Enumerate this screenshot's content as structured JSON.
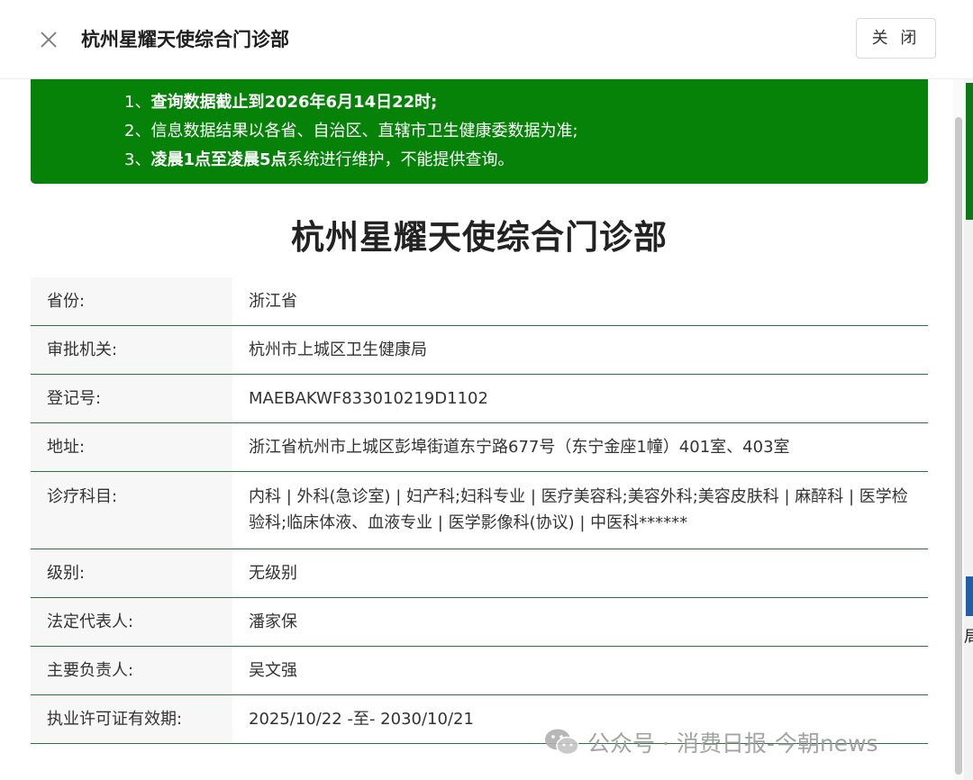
{
  "modal": {
    "title": "杭州星耀天使综合门诊部",
    "close_label": "关 闭"
  },
  "notice": {
    "lines": [
      {
        "num": "1、",
        "bold": "查询数据截止到2026年6月14日22时;",
        "normal": ""
      },
      {
        "num": "2、",
        "bold": "",
        "normal": "信息数据结果以各省、自治区、直辖市卫生健康委数据为准;"
      },
      {
        "num": "3、",
        "bold": "凌晨1点至凌晨5点",
        "normal": "系统进行维护，不能提供查询。"
      }
    ]
  },
  "main_title": "杭州星耀天使综合门诊部",
  "info": [
    {
      "label": "省份:",
      "value": "浙江省"
    },
    {
      "label": "审批机关:",
      "value": "杭州市上城区卫生健康局"
    },
    {
      "label": "登记号:",
      "value": "MAEBAKWF833010219D1102"
    },
    {
      "label": "地址:",
      "value": "浙江省杭州市上城区彭埠街道东宁路677号（东宁金座1幢）401室、403室"
    },
    {
      "label": "诊疗科目:",
      "value": "内科 | 外科(急诊室) | 妇产科;妇科专业 | 医疗美容科;美容外科;美容皮肤科 | 麻醉科 | 医学检验科;临床体液、血液专业 | 医学影像科(协议) | 中医科******"
    },
    {
      "label": "级别:",
      "value": "无级别"
    },
    {
      "label": "法定代表人:",
      "value": "潘家保"
    },
    {
      "label": "主要负责人:",
      "value": "吴文强"
    },
    {
      "label": "执业许可证有效期:",
      "value": "2025/10/22 -至- 2030/10/21"
    }
  ],
  "watermark": {
    "text": "公众号 · 消费日报-今朝news"
  },
  "background": {
    "edge_char": "局"
  },
  "colors": {
    "notice_bg": "#068209",
    "row_border": "#2f6f48",
    "label_bg": "#f7f7f7"
  },
  "icons": {
    "close": "close-icon",
    "watermark_logo": "wechat-icon"
  }
}
